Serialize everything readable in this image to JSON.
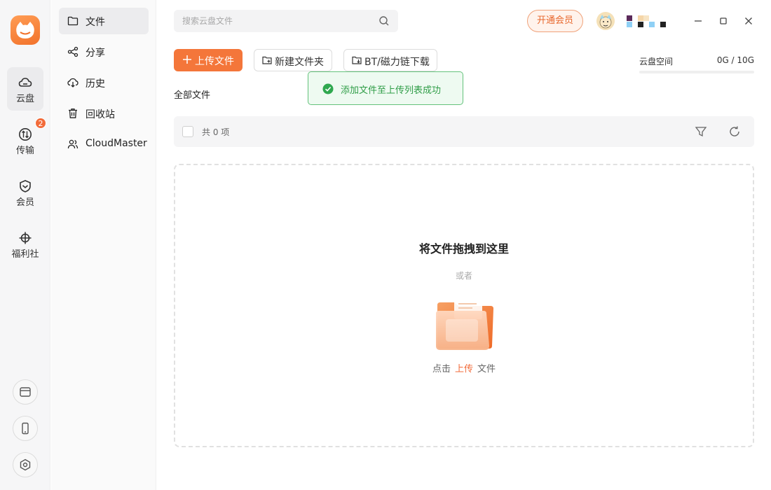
{
  "rail": {
    "items": [
      {
        "label": "云盘",
        "icon": "cloud-icon"
      },
      {
        "label": "传输",
        "icon": "transfer-icon",
        "badge": "2"
      },
      {
        "label": "会员",
        "icon": "shield-icon"
      },
      {
        "label": "福利社",
        "icon": "compass-icon"
      }
    ],
    "bottom_icons": [
      "browser-window-icon",
      "phone-icon",
      "settings-icon"
    ]
  },
  "nav": {
    "items": [
      {
        "label": "文件",
        "icon": "folder-icon"
      },
      {
        "label": "分享",
        "icon": "share-icon"
      },
      {
        "label": "历史",
        "icon": "history-download-icon"
      },
      {
        "label": "回收站",
        "icon": "trash-icon"
      },
      {
        "label": "CloudMaster",
        "icon": "users-icon"
      }
    ]
  },
  "search": {
    "placeholder": "搜索云盘文件"
  },
  "header": {
    "vip_label": "开通会员"
  },
  "toolbar": {
    "upload_label": "上传文件",
    "new_folder_label": "新建文件夹",
    "bt_label": "BT/磁力链下载"
  },
  "storage": {
    "label": "云盘空间",
    "value": "0G / 10G",
    "used_fraction": 0
  },
  "toast": {
    "message": "添加文件至上传列表成功"
  },
  "breadcrumb": {
    "label": "全部文件"
  },
  "listbar": {
    "count": "共 0 项"
  },
  "dropzone": {
    "title": "将文件拖拽到这里",
    "or": "或者",
    "click_prefix": "点击",
    "click_link": "上传",
    "click_suffix": "文件"
  },
  "colors": {
    "accent": "#f4763a",
    "success": "#2f9d47",
    "badge": "#f26b3a"
  }
}
